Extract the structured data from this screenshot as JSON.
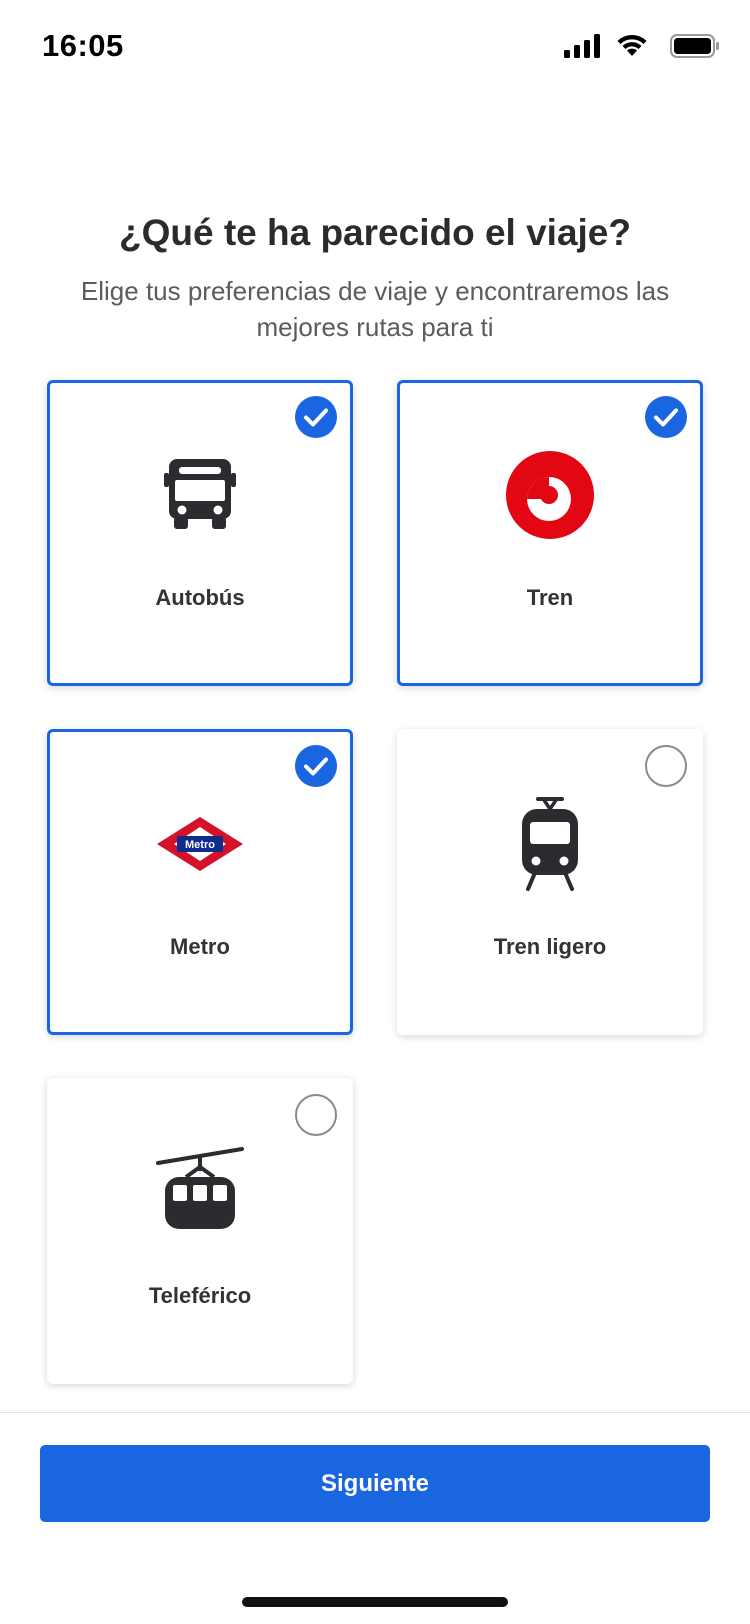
{
  "status_bar": {
    "time": "16:05",
    "icons": [
      "cellular-signal-icon",
      "wifi-icon",
      "battery-icon"
    ]
  },
  "header": {
    "title": "¿Qué te ha parecido el viaje?",
    "subtitle": "Elige tus preferencias de viaje y encontraremos las mejores rutas para ti"
  },
  "options": [
    {
      "label": "Autobús",
      "icon": "bus-icon",
      "selected": true
    },
    {
      "label": "Tren",
      "icon": "train-logo-icon",
      "selected": true
    },
    {
      "label": "Metro",
      "icon": "metro-logo-icon",
      "selected": true
    },
    {
      "label": "Tren ligero",
      "icon": "tram-icon",
      "selected": false
    },
    {
      "label": "Teleférico",
      "icon": "cable-car-icon",
      "selected": false
    }
  ],
  "metro_logo_text": "Metro",
  "footer": {
    "next_label": "Siguiente"
  },
  "colors": {
    "accent": "#1a66e0",
    "train_red": "#e30613",
    "metro_red": "#d4132a",
    "metro_blue": "#0f2b8c",
    "icon_dark": "#2b2b30"
  }
}
